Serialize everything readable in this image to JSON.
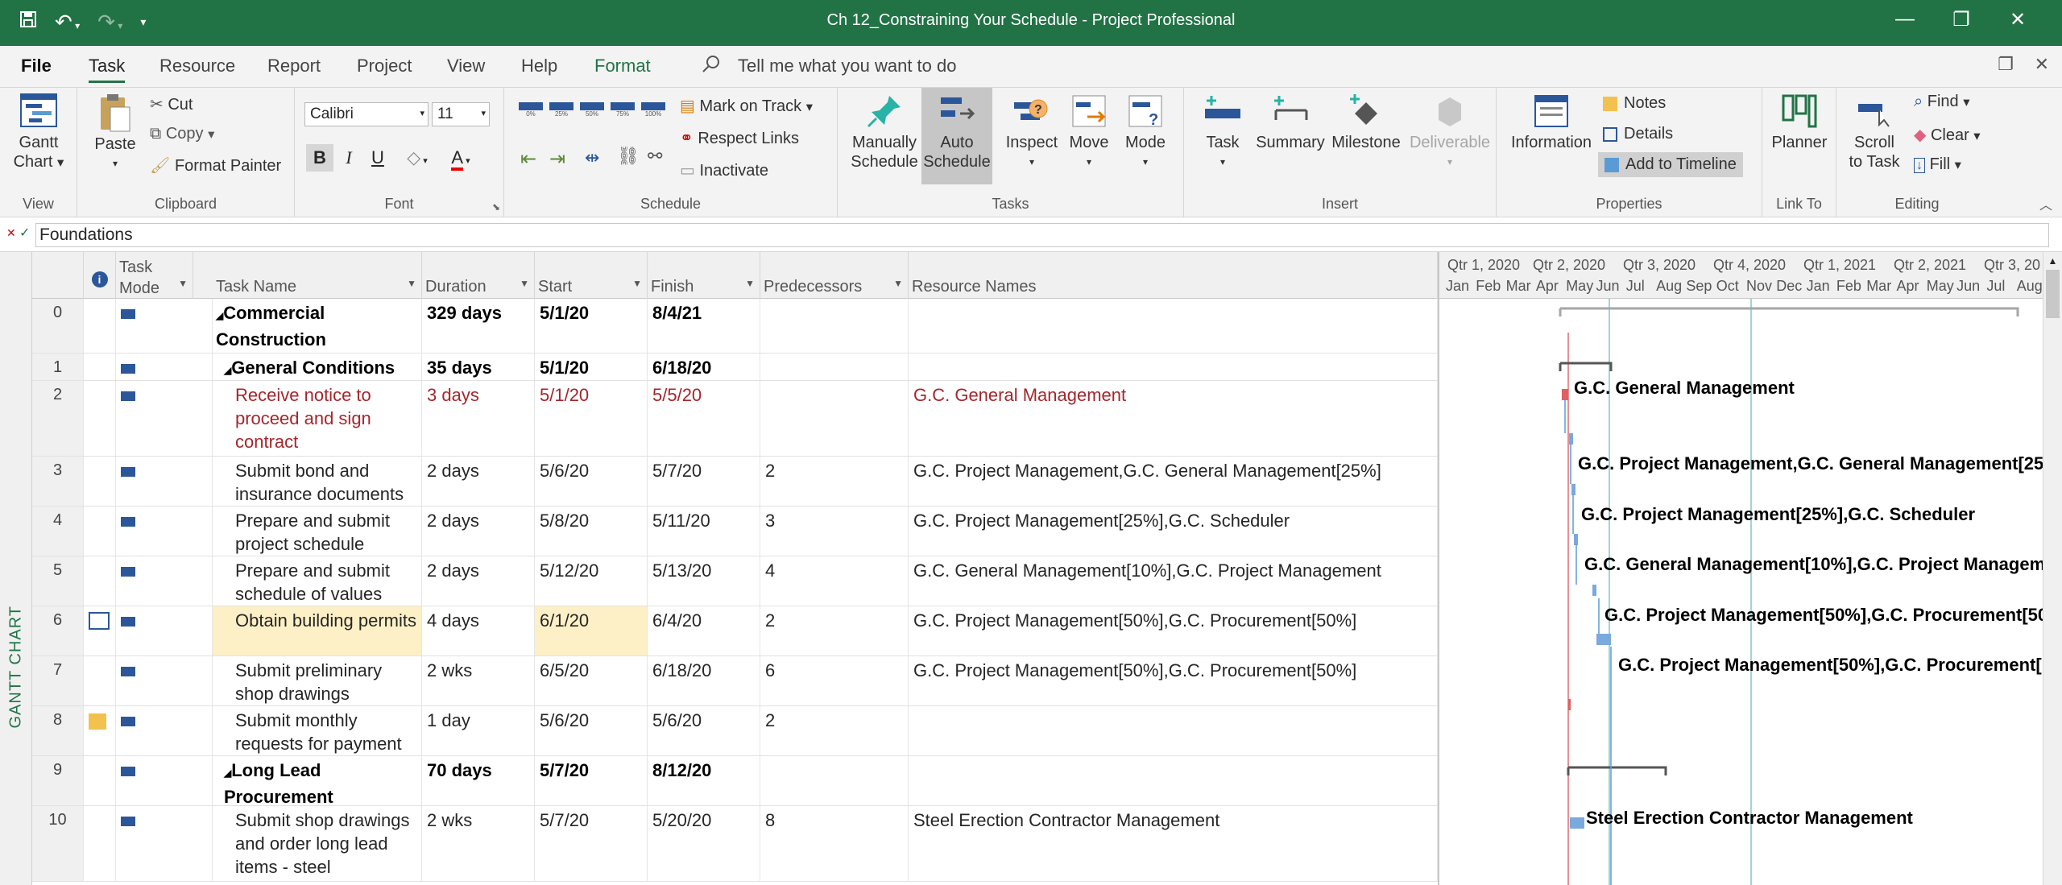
{
  "title_bar": {
    "title": "Ch 12_Constraining Your Schedule  -  Project Professional"
  },
  "tabs": [
    {
      "label": "File"
    },
    {
      "label": "Task"
    },
    {
      "label": "Resource"
    },
    {
      "label": "Report"
    },
    {
      "label": "Project"
    },
    {
      "label": "View"
    },
    {
      "label": "Help"
    },
    {
      "label": "Format"
    }
  ],
  "tell_me": "Tell me what you want to do",
  "ribbon": {
    "view": {
      "gantt": "Gantt",
      "chart": "Chart",
      "label": "View"
    },
    "clipboard": {
      "paste": "Paste",
      "cut": "Cut",
      "copy": "Copy",
      "format_painter": "Format Painter",
      "label": "Clipboard"
    },
    "font": {
      "family": "Calibri",
      "size": "11",
      "bold": "B",
      "italic": "I",
      "underline": "U",
      "label": "Font"
    },
    "schedule": {
      "mark_on_track": "Mark on Track",
      "respect_links": "Respect Links",
      "inactivate": "Inactivate",
      "label": "Schedule",
      "pct": [
        "0%",
        "25%",
        "50%",
        "75%",
        "100%"
      ]
    },
    "tasks": {
      "manually": "Manually",
      "schedule1": "Schedule",
      "auto": "Auto",
      "schedule2": "Schedule",
      "inspect": "Inspect",
      "move": "Move",
      "mode": "Mode",
      "label": "Tasks"
    },
    "insert": {
      "task": "Task",
      "summary": "Summary",
      "milestone": "Milestone",
      "deliverable": "Deliverable",
      "label": "Insert"
    },
    "properties": {
      "information": "Information",
      "notes": "Notes",
      "details": "Details",
      "add_to_timeline": "Add to Timeline",
      "label": "Properties"
    },
    "link_to": {
      "planner": "Planner",
      "label": "Link To"
    },
    "editing": {
      "scroll": "Scroll",
      "to_task": "to Task",
      "find": "Find",
      "clear": "Clear",
      "fill": "Fill",
      "label": "Editing"
    }
  },
  "entry_bar": {
    "value": "Foundations"
  },
  "side_label": "GANTT CHART",
  "columns": {
    "info": "i",
    "task_mode": "Task\nMode",
    "task_name": "Task Name",
    "duration": "Duration",
    "start": "Start",
    "finish": "Finish",
    "predecessors": "Predecessors",
    "resource_names": "Resource Names"
  },
  "rows": [
    {
      "id": "0",
      "name": "Commercial Construction",
      "duration": "329 days",
      "start": "5/1/20",
      "finish": "8/4/21",
      "pred": "",
      "res": ""
    },
    {
      "id": "1",
      "name": "General Conditions",
      "duration": "35 days",
      "start": "5/1/20",
      "finish": "6/18/20",
      "pred": "",
      "res": ""
    },
    {
      "id": "2",
      "name": "Receive notice to proceed and sign contract",
      "duration": "3 days",
      "start": "5/1/20",
      "finish": "5/5/20",
      "pred": "",
      "res": "G.C. General Management"
    },
    {
      "id": "3",
      "name": "Submit bond and insurance documents",
      "duration": "2 days",
      "start": "5/6/20",
      "finish": "5/7/20",
      "pred": "2",
      "res": "G.C. Project Management,G.C. General Management[25%]"
    },
    {
      "id": "4",
      "name": "Prepare and submit project schedule",
      "duration": "2 days",
      "start": "5/8/20",
      "finish": "5/11/20",
      "pred": "3",
      "res": "G.C. Project Management[25%],G.C. Scheduler"
    },
    {
      "id": "5",
      "name": "Prepare and submit schedule of values",
      "duration": "2 days",
      "start": "5/12/20",
      "finish": "5/13/20",
      "pred": "4",
      "res": "G.C. General Management[10%],G.C. Project Management"
    },
    {
      "id": "6",
      "name": "Obtain building permits",
      "duration": "4 days",
      "start": "6/1/20",
      "finish": "6/4/20",
      "pred": "2",
      "res": "G.C. Project Management[50%],G.C. Procurement[50%]"
    },
    {
      "id": "7",
      "name": "Submit preliminary shop drawings",
      "duration": "2 wks",
      "start": "6/5/20",
      "finish": "6/18/20",
      "pred": "6",
      "res": "G.C. Project Management[50%],G.C. Procurement[50%]"
    },
    {
      "id": "8",
      "name": "Submit monthly requests for payment",
      "duration": "1 day",
      "start": "5/6/20",
      "finish": "5/6/20",
      "pred": "2",
      "res": ""
    },
    {
      "id": "9",
      "name": "Long Lead Procurement",
      "duration": "70 days",
      "start": "5/7/20",
      "finish": "8/12/20",
      "pred": "",
      "res": ""
    },
    {
      "id": "10",
      "name": "Submit shop drawings and order long lead items - steel",
      "duration": "2 wks",
      "start": "5/7/20",
      "finish": "5/20/20",
      "pred": "8",
      "res": "Steel Erection Contractor Management"
    }
  ],
  "timescale": {
    "quarters": [
      "Qtr 1, 2020",
      "Qtr 2, 2020",
      "Qtr 3, 2020",
      "Qtr 4, 2020",
      "Qtr 1, 2021",
      "Qtr 2, 2021",
      "Qtr 3, 20"
    ],
    "months": [
      "Jan",
      "Feb",
      "Mar",
      "Apr",
      "May",
      "Jun",
      "Jul",
      "Aug",
      "Sep",
      "Oct",
      "Nov",
      "Dec",
      "Jan",
      "Feb",
      "Mar",
      "Apr",
      "May",
      "Jun",
      "Jul",
      "Aug"
    ]
  },
  "gantt_labels": [
    "G.C. General Management",
    "G.C. Project Management,G.C. General Management[25",
    "G.C. Project Management[25%],G.C. Scheduler",
    "G.C. General Management[10%],G.C. Project Managem",
    "G.C. Project Management[50%],G.C. Procurement[50",
    "G.C. Project Management[50%],G.C. Procurement[!",
    "Steel Erection Contractor Management"
  ],
  "colors": {
    "brand": "#217346",
    "highlight": "#fdf0c7",
    "late": "#a4262c",
    "bar": "#7aa9dc"
  }
}
